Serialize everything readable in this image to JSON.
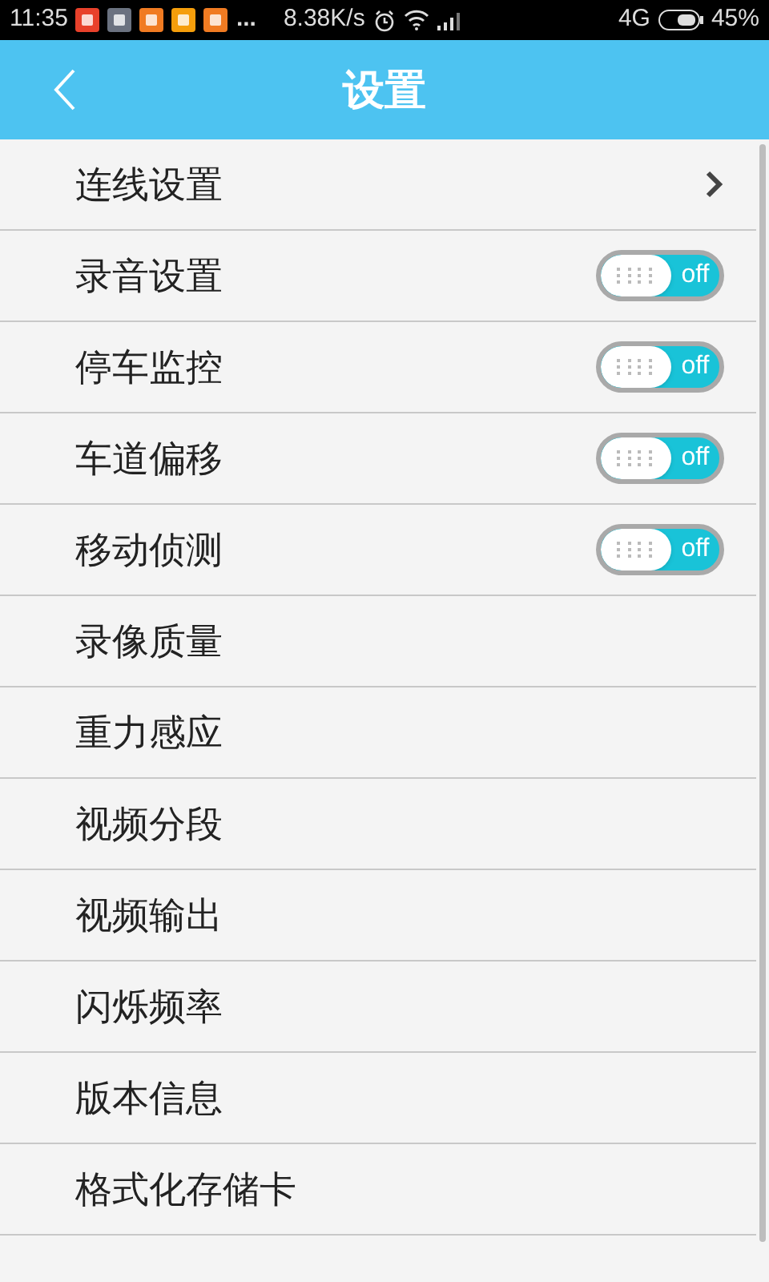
{
  "status_bar": {
    "time": "11:35",
    "more": "...",
    "speed": "8.38K/s",
    "network": "4G",
    "battery": "45%"
  },
  "header": {
    "title": "设置"
  },
  "items": [
    {
      "label": "连线设置",
      "kind": "arrow"
    },
    {
      "label": "录音设置",
      "kind": "toggle",
      "on": false,
      "toggle_text": "off"
    },
    {
      "label": "停车监控",
      "kind": "toggle",
      "on": false,
      "toggle_text": "off"
    },
    {
      "label": "车道偏移",
      "kind": "toggle",
      "on": false,
      "toggle_text": "off"
    },
    {
      "label": "移动侦测",
      "kind": "toggle",
      "on": false,
      "toggle_text": "off"
    },
    {
      "label": "录像质量",
      "kind": "plain"
    },
    {
      "label": "重力感应",
      "kind": "plain"
    },
    {
      "label": "视频分段",
      "kind": "plain"
    },
    {
      "label": "视频输出",
      "kind": "plain"
    },
    {
      "label": "闪烁频率",
      "kind": "plain"
    },
    {
      "label": "版本信息",
      "kind": "plain"
    },
    {
      "label": "格式化存储卡",
      "kind": "plain"
    },
    {
      "kind": "plain"
    }
  ]
}
